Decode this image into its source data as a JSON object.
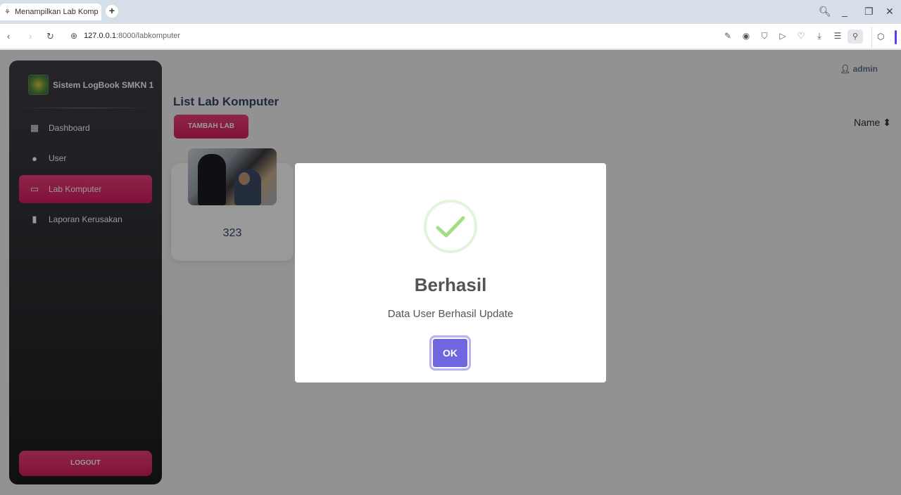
{
  "browser": {
    "tab_title": "Menampilkan Lab Kompu",
    "url_host": "127.0.0.1",
    "url_path": ":8000/labkomputer"
  },
  "sidebar": {
    "brand": "Sistem LogBook SMKN 1",
    "items": [
      {
        "label": "Dashboard",
        "icon": "dashboard-icon"
      },
      {
        "label": "User",
        "icon": "user-icon"
      },
      {
        "label": "Lab Komputer",
        "icon": "laptop-icon",
        "active": true
      },
      {
        "label": "Laporan Kerusakan",
        "icon": "book-icon"
      }
    ],
    "logout": "LOGOUT"
  },
  "header": {
    "user": "admin"
  },
  "main": {
    "title": "List Lab Komputer",
    "add_button": "TAMBAH LAB",
    "sort_label": "Name",
    "cards": [
      {
        "label": "323"
      }
    ]
  },
  "modal": {
    "title": "Berhasil",
    "text": "Data User Berhasil Update",
    "ok": "OK",
    "accent": "#7066e0",
    "success_color": "#a5dc86"
  }
}
